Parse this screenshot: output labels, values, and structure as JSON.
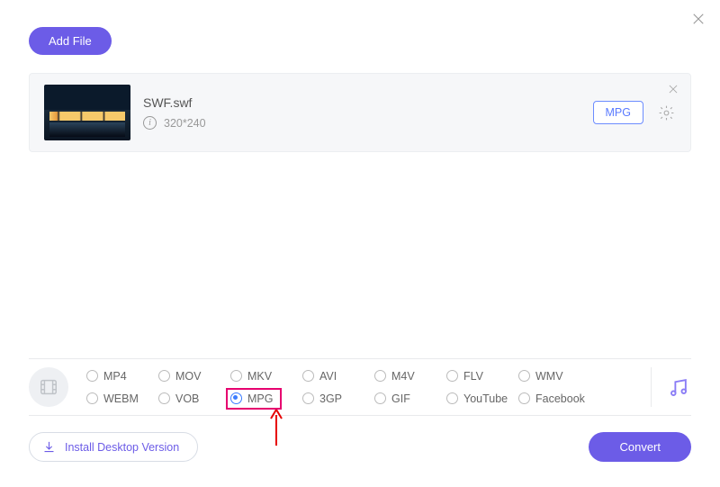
{
  "header": {
    "add_file_label": "Add File"
  },
  "file": {
    "name": "SWF.swf",
    "resolution": "320*240",
    "target_format": "MPG"
  },
  "formats": {
    "row1": [
      "MP4",
      "MOV",
      "MKV",
      "AVI",
      "M4V",
      "FLV",
      "WMV"
    ],
    "row2": [
      "WEBM",
      "VOB",
      "MPG",
      "3GP",
      "GIF",
      "YouTube",
      "Facebook"
    ],
    "selected": "MPG"
  },
  "footer": {
    "install_label": "Install Desktop Version",
    "convert_label": "Convert"
  }
}
